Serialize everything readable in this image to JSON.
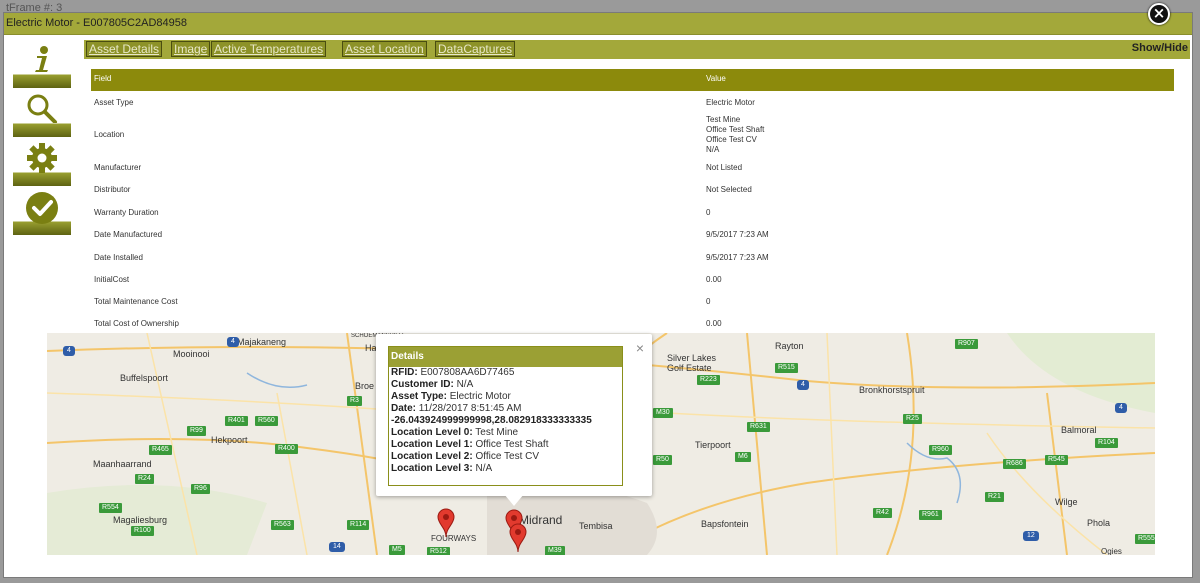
{
  "background": {
    "partial_text": "tFrame #: 3"
  },
  "modal": {
    "title": "Electric Motor - E007805C2AD84958",
    "close_symbol": "×"
  },
  "side_icons": [
    {
      "name": "info-icon"
    },
    {
      "name": "search-icon"
    },
    {
      "name": "gear-icon"
    },
    {
      "name": "check-icon"
    }
  ],
  "tabs": [
    "Asset Details",
    "Image",
    "Active Temperatures",
    "Asset Location",
    "DataCaptures"
  ],
  "show_hide": "Show/Hide",
  "table": {
    "headers": {
      "field": "Field",
      "value": "Value"
    },
    "rows": [
      {
        "field": "Asset Type",
        "value": "Electric Motor"
      },
      {
        "field": "Location",
        "value": "Test Mine\nOffice Test Shaft\nOffice Test CV\nN/A"
      },
      {
        "field": "Manufacturer",
        "value": "Not Listed"
      },
      {
        "field": "Distributor",
        "value": "Not Selected"
      },
      {
        "field": "Warranty Duration",
        "value": "0"
      },
      {
        "field": "Date Manufactured",
        "value": "9/5/2017 7:23 AM"
      },
      {
        "field": "Date Installed",
        "value": "9/5/2017 7:23 AM"
      },
      {
        "field": "InitialCost",
        "value": "0.00"
      },
      {
        "field": "Total Maintenance Cost",
        "value": "0"
      },
      {
        "field": "Total Cost of Ownership",
        "value": "0.00"
      }
    ]
  },
  "map": {
    "places": [
      "Majakaneng",
      "Mooinooi",
      "Buffelspoort",
      "Hekpoort",
      "Maanhaarrand",
      "Magaliesburg",
      "Broe",
      "Har",
      "Silver Lakes\nGolf Estate",
      "Rayton",
      "Bronkhorstspruit",
      "Tierpoort",
      "Balmoral",
      "Wilge",
      "Phola",
      "Bapsfontein",
      "Tembisa",
      "Midrand",
      "FOURWAYS",
      "Ogies",
      "SCHOEMANSVILLE"
    ],
    "route_shields": [
      "R401",
      "R560",
      "R99",
      "R400",
      "R465",
      "R24",
      "R96",
      "R554",
      "R100",
      "R563",
      "R114",
      "R3",
      "R515",
      "R223",
      "R631",
      "R25",
      "R50",
      "M6",
      "R960",
      "R686",
      "R545",
      "R104",
      "R42",
      "R961",
      "R555",
      "R21",
      "M30",
      "M5",
      "M39",
      "R512",
      "R907"
    ],
    "national_shields": [
      "4",
      "4",
      "4",
      "14",
      "12",
      "4"
    ],
    "popup": {
      "header": "Details",
      "lines": [
        {
          "label": "RFID:",
          "value": " E007808AA6D77465"
        },
        {
          "label": "Customer ID:",
          "value": " N/A"
        },
        {
          "label": "Asset Type:",
          "value": " Electric Motor"
        },
        {
          "label": "Date:",
          "value": " 11/28/2017 8:51:45 AM"
        },
        {
          "label": "-26.043924999999998,28.082918333333335",
          "value": ""
        },
        {
          "label": "Location Level 0:",
          "value": " Test Mine"
        },
        {
          "label": "Location Level 1:",
          "value": " Office Test Shaft"
        },
        {
          "label": "Location Level 2:",
          "value": " Office Test CV"
        },
        {
          "label": "Location Level 3:",
          "value": " N/A"
        }
      ],
      "close_symbol": "×"
    },
    "marker_color": "#e23a2e"
  },
  "colors": {
    "accent": "#a3a83a",
    "table_header": "#8c8a0c"
  }
}
